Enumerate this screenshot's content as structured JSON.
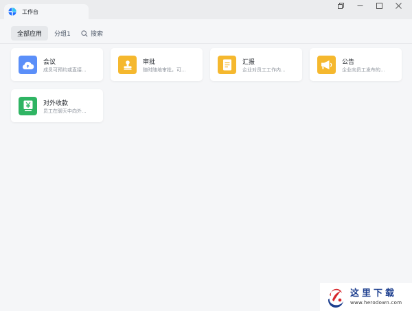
{
  "window": {
    "tab_title": "工作台",
    "controls": [
      "restore-window-icon",
      "minimize-icon",
      "maximize-icon",
      "close-icon"
    ]
  },
  "subnav": {
    "tabs": [
      {
        "label": "全部应用",
        "active": true
      },
      {
        "label": "分组1",
        "active": false
      }
    ],
    "search_label": "搜索"
  },
  "apps": [
    {
      "title": "会议",
      "desc": "成员可预约或直接...",
      "icon": "cloud-icon",
      "color": "#5b8ff9"
    },
    {
      "title": "审批",
      "desc": "随时随地审批，可...",
      "icon": "stamp-icon",
      "color": "#f5b82e"
    },
    {
      "title": "汇报",
      "desc": "企业对员工工作内...",
      "icon": "document-icon",
      "color": "#f5b82e"
    },
    {
      "title": "公告",
      "desc": "企业向员工发布的...",
      "icon": "megaphone-icon",
      "color": "#f5b82e"
    },
    {
      "title": "对外收款",
      "desc": "员工在聊天中向外...",
      "icon": "yuan-icon",
      "color": "#2fb463"
    }
  ],
  "watermark": {
    "chinese": "这里下载",
    "url": "www.herodown.com"
  }
}
